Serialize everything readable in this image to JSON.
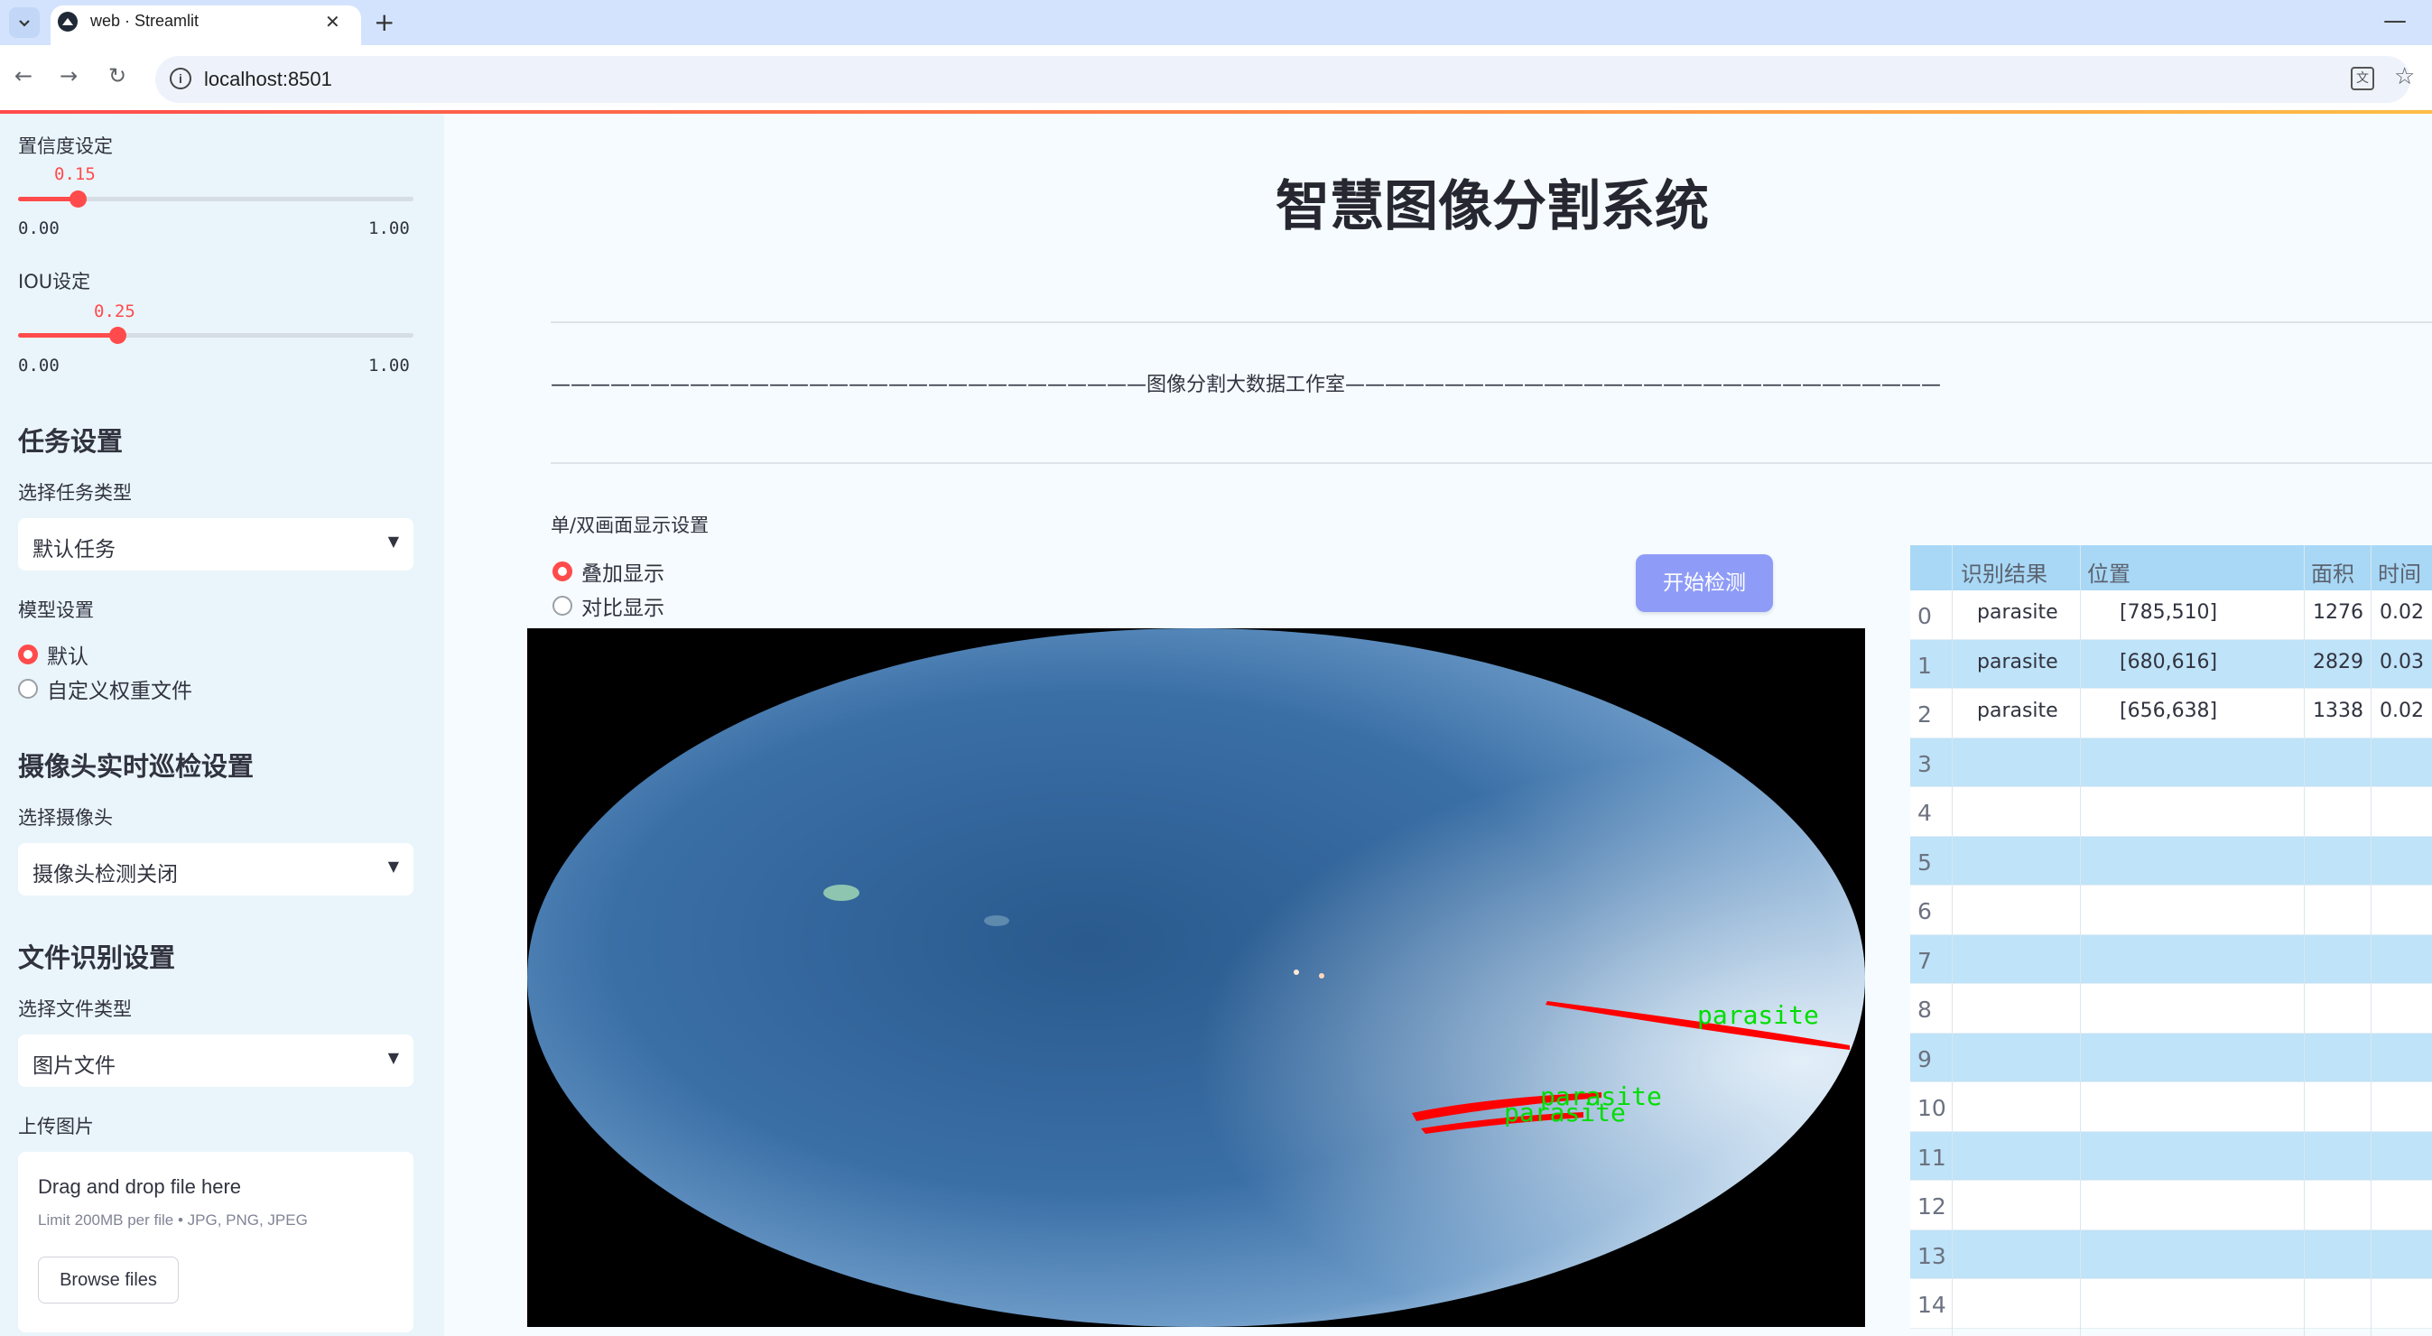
{
  "browser": {
    "tab_title": "web · Streamlit",
    "url": "localhost:8501"
  },
  "sidebar": {
    "confidence": {
      "label": "置信度设定",
      "value_text": "0.15",
      "value": 0.15,
      "min": "0.00",
      "max": "1.00"
    },
    "iou": {
      "label": "IOU设定",
      "value_text": "0.25",
      "value": 0.25,
      "min": "0.00",
      "max": "1.00"
    },
    "task_section": {
      "heading": "任务设置",
      "select_label": "选择任务类型",
      "selected": "默认任务",
      "model_label": "模型设置",
      "options": [
        "默认",
        "自定义权重文件"
      ],
      "selected_index": 0
    },
    "camera_section": {
      "heading": "摄像头实时巡检设置",
      "select_label": "选择摄像头",
      "selected": "摄像头检测关闭"
    },
    "file_section": {
      "heading": "文件识别设置",
      "select_label": "选择文件类型",
      "selected": "图片文件",
      "upload_label": "上传图片",
      "drop_text": "Drag and drop file here",
      "limit_text": "Limit 200MB per file • JPG, PNG, JPEG",
      "browse_label": "Browse files"
    }
  },
  "main": {
    "title": "智慧图像分割系统",
    "divider_text": "——————————————————————————————图像分割大数据工作室——————————————————————————————",
    "display_label": "单/双画面显示设置",
    "display_options": [
      "叠加显示",
      "对比显示"
    ],
    "display_selected_index": 0,
    "detect_button": "开始检测",
    "overlay_labels": [
      "parasite",
      "parasite",
      "parasite"
    ]
  },
  "table": {
    "columns": [
      "识别结果",
      "位置",
      "面积",
      "时间"
    ],
    "rows": [
      {
        "index": "0",
        "result": "parasite",
        "position": "[785,510]",
        "area": "1276",
        "time": "0.02"
      },
      {
        "index": "1",
        "result": "parasite",
        "position": "[680,616]",
        "area": "2829",
        "time": "0.03"
      },
      {
        "index": "2",
        "result": "parasite",
        "position": "[656,638]",
        "area": "1338",
        "time": "0.02"
      },
      {
        "index": "3",
        "result": "",
        "position": "",
        "area": "",
        "time": ""
      },
      {
        "index": "4",
        "result": "",
        "position": "",
        "area": "",
        "time": ""
      },
      {
        "index": "5",
        "result": "",
        "position": "",
        "area": "",
        "time": ""
      },
      {
        "index": "6",
        "result": "",
        "position": "",
        "area": "",
        "time": ""
      },
      {
        "index": "7",
        "result": "",
        "position": "",
        "area": "",
        "time": ""
      },
      {
        "index": "8",
        "result": "",
        "position": "",
        "area": "",
        "time": ""
      },
      {
        "index": "9",
        "result": "",
        "position": "",
        "area": "",
        "time": ""
      },
      {
        "index": "10",
        "result": "",
        "position": "",
        "area": "",
        "time": ""
      },
      {
        "index": "11",
        "result": "",
        "position": "",
        "area": "",
        "time": ""
      },
      {
        "index": "12",
        "result": "",
        "position": "",
        "area": "",
        "time": ""
      },
      {
        "index": "13",
        "result": "",
        "position": "",
        "area": "",
        "time": ""
      },
      {
        "index": "14",
        "result": "",
        "position": "",
        "area": "",
        "time": ""
      }
    ]
  },
  "colors": {
    "accent": "#ff4b4b",
    "button": "#8f9cf7",
    "sidebar_bg": "#eaf5fb",
    "table_header": "#a8d8f5",
    "detection_mask": "#ff0000",
    "detection_label": "#00dd00"
  },
  "icons": [
    "chevron-down-icon",
    "streamlit-icon",
    "close-icon",
    "plus-icon",
    "minimize-icon",
    "back-icon",
    "forward-icon",
    "reload-icon",
    "info-icon",
    "translate-icon",
    "star-icon",
    "caret-down-icon"
  ]
}
